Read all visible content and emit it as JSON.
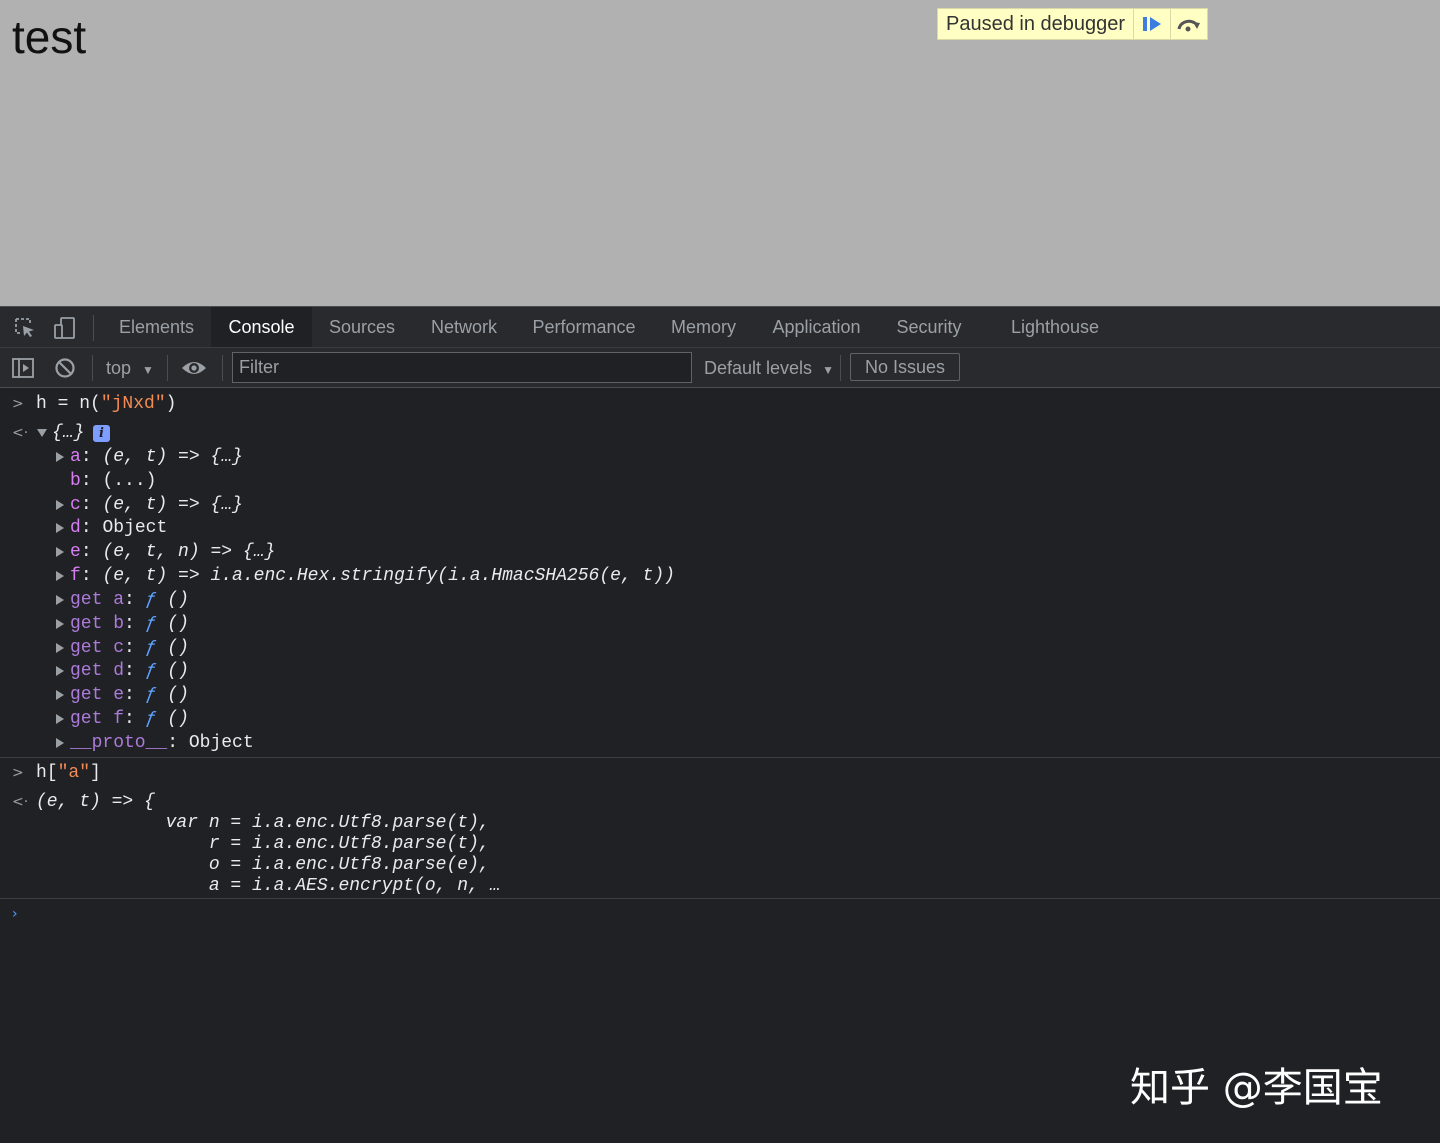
{
  "page": {
    "heading": "test",
    "debugger_banner": {
      "label": "Paused in debugger",
      "resume_icon": "resume-icon",
      "step_over_icon": "step-over-icon"
    }
  },
  "devtools": {
    "tabs": [
      {
        "label": "Elements",
        "active": false
      },
      {
        "label": "Console",
        "active": true
      },
      {
        "label": "Sources",
        "active": false
      },
      {
        "label": "Network",
        "active": false
      },
      {
        "label": "Performance",
        "active": false
      },
      {
        "label": "Memory",
        "active": false
      },
      {
        "label": "Application",
        "active": false
      },
      {
        "label": "Security",
        "active": false
      },
      {
        "label": "Lighthouse",
        "active": false
      }
    ],
    "toolbar": {
      "context": "top",
      "filter_placeholder": "Filter",
      "levels": "Default levels",
      "issues": "No Issues"
    },
    "console": {
      "entry1": {
        "input": {
          "var": "h",
          "op": " = ",
          "fn": "n(",
          "arg": "\"jNxd\"",
          "close": ")"
        },
        "result_summary": "{…}",
        "properties": [
          {
            "key": "a",
            "value": "(e, t) => {…}",
            "expandable": true
          },
          {
            "key": "b",
            "value": "(...)",
            "expandable": false
          },
          {
            "key": "c",
            "value": "(e, t) => {…}",
            "expandable": true
          },
          {
            "key": "d",
            "value": "Object",
            "expandable": true
          },
          {
            "key": "e",
            "value": "(e, t, n) => {…}",
            "expandable": true
          },
          {
            "key": "f",
            "value": "(e, t) => i.a.enc.Hex.stringify(i.a.HmacSHA256(e, t))",
            "expandable": true
          }
        ],
        "getters": [
          {
            "prefix": "get",
            "key": "a",
            "value": "()"
          },
          {
            "prefix": "get",
            "key": "b",
            "value": "()"
          },
          {
            "prefix": "get",
            "key": "c",
            "value": "()"
          },
          {
            "prefix": "get",
            "key": "d",
            "value": "()"
          },
          {
            "prefix": "get",
            "key": "e",
            "value": "()"
          },
          {
            "prefix": "get",
            "key": "f",
            "value": "()"
          }
        ],
        "proto": {
          "key": "__proto__",
          "value": "Object"
        }
      },
      "entry2": {
        "input": {
          "var": "h[",
          "arg": "\"a\"",
          "close": "]"
        },
        "result_lines": [
          "(e, t) => {",
          "            var n = i.a.enc.Utf8.parse(t),",
          "                r = i.a.enc.Utf8.parse(t),",
          "                o = i.a.enc.Utf8.parse(e),",
          "                a = i.a.AES.encrypt(o, n, …"
        ]
      },
      "getter_symbol": "ƒ",
      "colon": ":"
    }
  },
  "watermark": "知乎 @李国宝"
}
